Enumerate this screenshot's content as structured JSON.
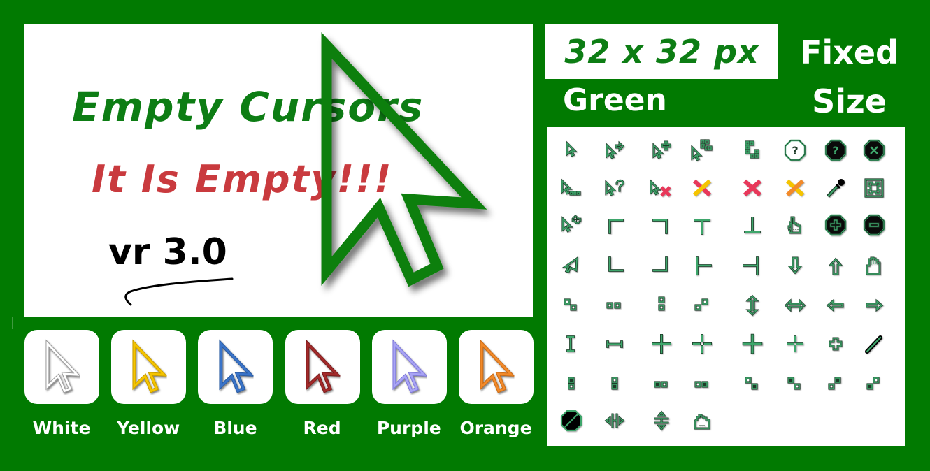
{
  "banner": {
    "title": "Empty Cursors",
    "subtitle": "It Is Empty!!!",
    "version": "vr 3.0",
    "main_icon": "large-arrow-cursor-outline",
    "colors": {
      "background": "#017a01",
      "title": "#0d7d14",
      "subtitle": "#c93a3e",
      "cursor_outline": "#0b7f0b"
    }
  },
  "size_info": {
    "size": "32 x 32 px",
    "color_name": "Green",
    "fixed_label_line1": "Fixed",
    "fixed_label_line2": "Size"
  },
  "color_variants": [
    {
      "label": "White",
      "color": "#ffffff",
      "outline": "#9a9a9a"
    },
    {
      "label": "Yellow",
      "color": "#f5c400",
      "outline": "#c79c00"
    },
    {
      "label": "Blue",
      "color": "#3a74c9",
      "outline": "#2a5aa0"
    },
    {
      "label": "Red",
      "color": "#a32a2a",
      "outline": "#7a1d1d"
    },
    {
      "label": "Purple",
      "color": "#a9a4f5",
      "outline": "#7d77d8"
    },
    {
      "label": "Orange",
      "color": "#f28a2a",
      "outline": "#c96a12"
    }
  ],
  "cursor_set": {
    "icon_color": "#3ea66b",
    "icons": [
      [
        "arrow-icon",
        "arrow-move-right-icon",
        "arrow-plus-icon",
        "arrow-blocks-icon",
        "blocks-corner-icon",
        "help-octagon-icon",
        "help-octagon-filled-icon",
        "close-octagon-filled-icon"
      ],
      [
        "arrow-working-icon",
        "arrow-help-icon",
        "arrow-no-icon",
        "x-yellow-red-icon",
        "x-red-icon",
        "x-orange-yellow-icon",
        "pipette-icon",
        "resize-all-icon"
      ],
      [
        "arrow-move-icon",
        "corner-top-left-icon",
        "corner-top-right-icon",
        "tee-top-icon",
        "tee-bottom-icon",
        "hand-pointer-icon",
        "zoom-in-octagon-icon",
        "zoom-out-octagon-icon"
      ],
      [
        "arrow-left-tilted-icon",
        "corner-bottom-left-icon",
        "corner-bottom-right-icon",
        "tee-left-icon",
        "tee-right-icon",
        "arrow-down-icon",
        "arrow-up-icon",
        "hand-open-icon"
      ],
      [
        "resize-nwse-blocks-icon",
        "resize-we-blocks-icon",
        "resize-ns-blocks-icon",
        "resize-nesw-blocks-icon",
        "resize-ns-arrow-icon",
        "resize-we-arrow-icon",
        "arrow-left-icon",
        "arrow-right-icon"
      ],
      [
        "text-beam-icon",
        "text-beam-horizontal-icon",
        "crosshair-icon",
        "crosshair-gap-icon",
        "crosshair-bold-icon",
        "crosshair-small-gap-icon",
        "plus-outline-icon",
        "pencil-icon"
      ],
      [
        "blocks-v-top-icon",
        "blocks-v-bottom-icon",
        "blocks-h-left-icon",
        "blocks-h-right-icon",
        "blocks-diag-se-icon",
        "blocks-diag-nw-icon",
        "blocks-diag-ne-icon",
        "blocks-diag-sw-icon"
      ],
      [
        "not-allowed-icon",
        "split-horizontal-icon",
        "split-vertical-icon",
        "hand-grab-icon"
      ]
    ]
  }
}
